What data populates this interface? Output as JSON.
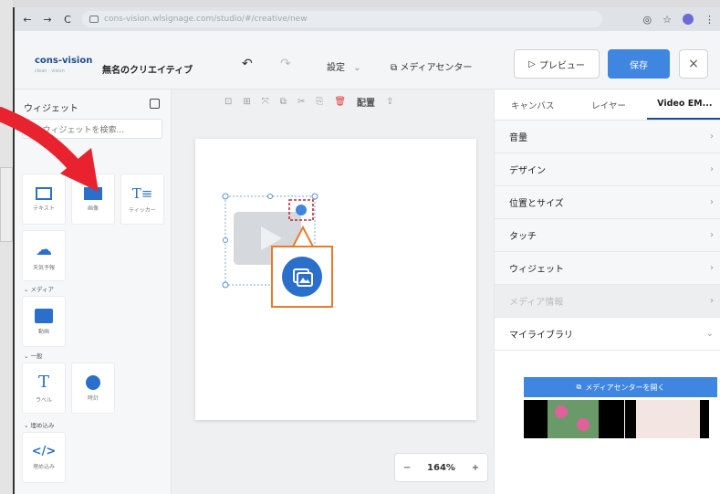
{
  "browser": {
    "url": "cons-vision.wlsignage.com/studio/#/creative/new",
    "back_icon": "←",
    "forward_icon": "→",
    "reload_icon": "C"
  },
  "app": {
    "logo": "cons-vision",
    "logo_sub": "clean · vision",
    "title": "無名のクリエイティブ",
    "settings_label": "設定",
    "media_center_label": "メディアセンター",
    "preview_label": "プレビュー",
    "save_label": "保存",
    "close_label": "×"
  },
  "widget_panel": {
    "title": "ウィジェット",
    "search_placeholder": "ウィジェットを検索...",
    "tiles_row1": [
      "テキスト",
      "画像",
      "ティッカー"
    ],
    "weather_label": "天気予報",
    "section_media": "メディア",
    "video_label": "動画",
    "section_general": "一般",
    "label_label": "ラベル",
    "clock_label": "時計",
    "section_embed": "埋め込み",
    "embed_label": "埋め込み"
  },
  "canvas": {
    "arrange_label": "配置",
    "zoom": "164%",
    "zoom_minus": "−",
    "zoom_plus": "+"
  },
  "right_panel": {
    "tabs": [
      "キャンバス",
      "レイヤー",
      "Video EM..."
    ],
    "rows": [
      "音量",
      "デザイン",
      "位置とサイズ",
      "タッチ",
      "ウィジェット",
      "メディア情報",
      "マイライブラリ"
    ],
    "open_media_label": "メディアセンターを開く"
  },
  "colors": {
    "accent": "#3f86e0",
    "arrow": "#e8222e",
    "callout": "#e87a2a"
  }
}
